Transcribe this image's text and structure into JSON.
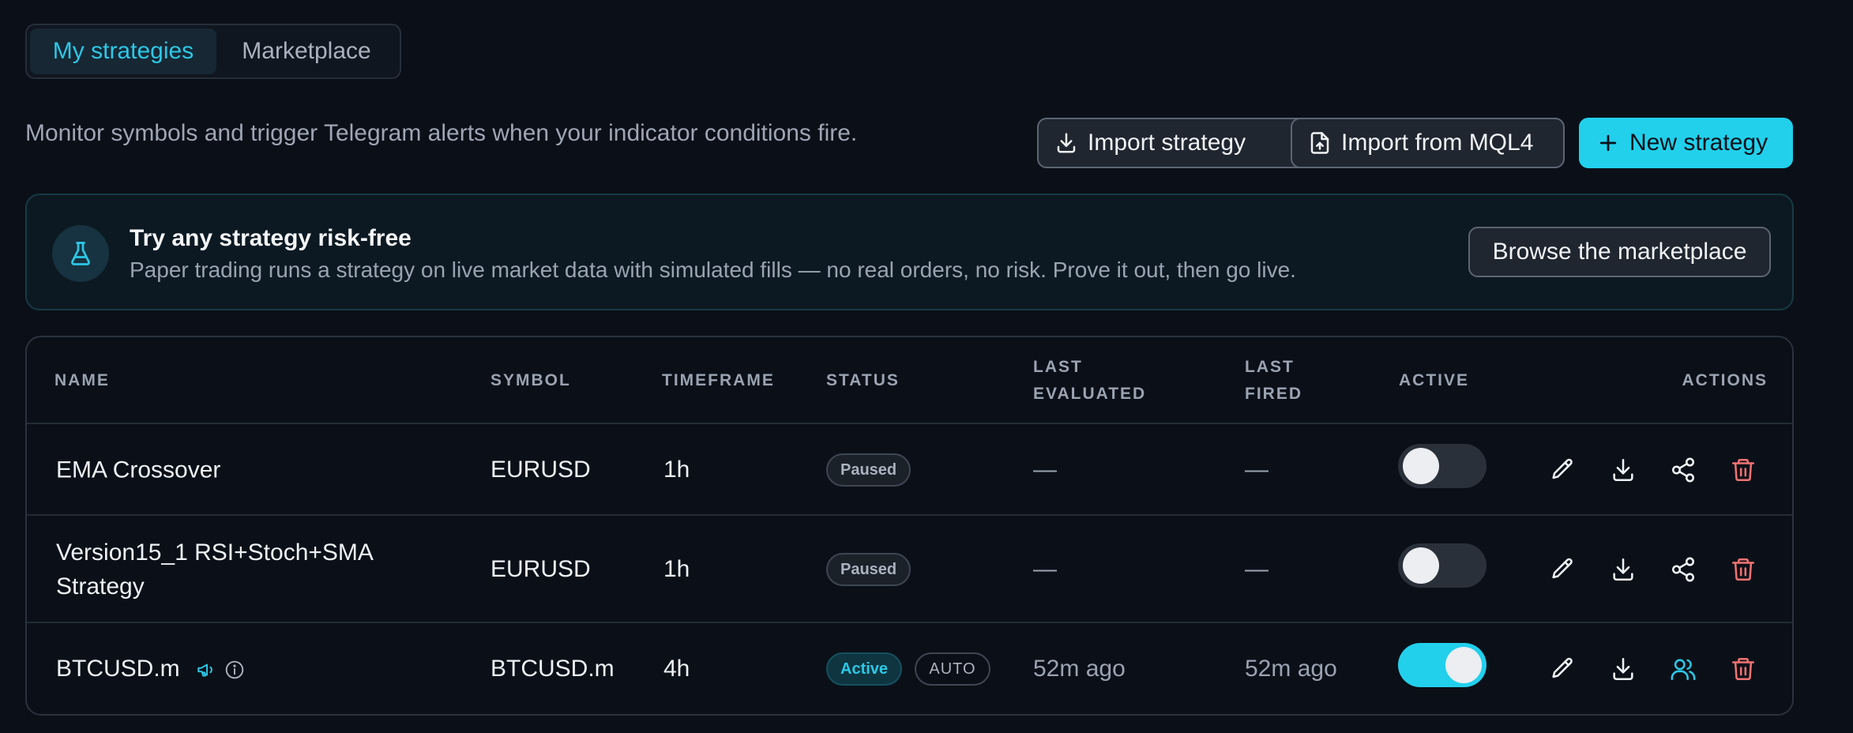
{
  "tabs": [
    {
      "label": "My strategies",
      "active": true
    },
    {
      "label": "Marketplace",
      "active": false
    }
  ],
  "description": "Monitor symbols and trigger Telegram alerts when your indicator conditions fire.",
  "buttons": {
    "import_strategy": "Import strategy",
    "import_mql4": "Import from MQL4",
    "new_strategy": "New strategy"
  },
  "banner": {
    "title": "Try any strategy risk-free",
    "text": "Paper trading runs a strategy on live market data with simulated fills — no real orders, no risk. Prove it out, then go live.",
    "button": "Browse the marketplace",
    "icon": "flask-icon"
  },
  "table": {
    "headers": {
      "name": "NAME",
      "symbol": "SYMBOL",
      "timeframe": "TIMEFRAME",
      "status": "STATUS",
      "last_evaluated_1": "LAST",
      "last_evaluated_2": "EVALUATED",
      "last_fired_1": "LAST",
      "last_fired_2": "FIRED",
      "active": "ACTIVE",
      "actions": "ACTIONS"
    },
    "rows": [
      {
        "name": "EMA Crossover",
        "symbol": "EURUSD",
        "timeframe": "1h",
        "status": "Paused",
        "last_evaluated": "—",
        "last_fired": "—",
        "active": false
      },
      {
        "name": "Version15_1 RSI+Stoch+SMA Strategy",
        "symbol": "EURUSD",
        "timeframe": "1h",
        "status": "Paused",
        "last_evaluated": "—",
        "last_fired": "—",
        "active": false
      },
      {
        "name": "BTCUSD.m",
        "symbol": "BTCUSD.m",
        "timeframe": "4h",
        "status": "Active",
        "mode": "AUTO",
        "last_evaluated": "52m ago",
        "last_fired": "52m ago",
        "active": true
      }
    ]
  },
  "colors": {
    "accent": "#22d0ec",
    "danger": "#f07272",
    "background": "#0b1018"
  }
}
